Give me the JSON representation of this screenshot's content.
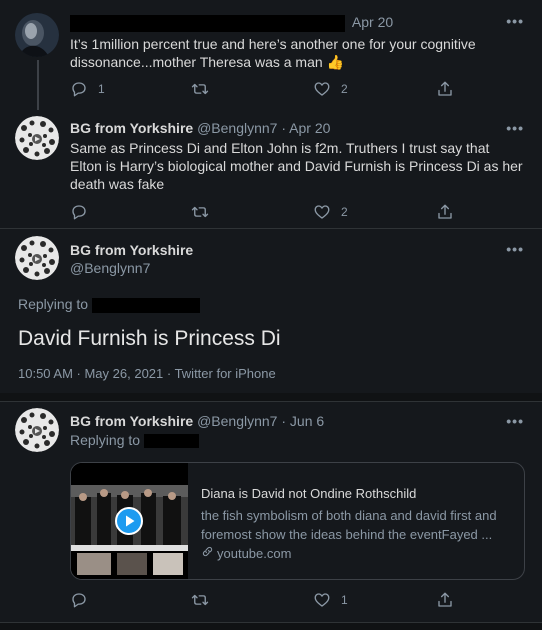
{
  "colors": {
    "background": "#15181c",
    "text": "#d9d9d9",
    "muted": "#8b98a5",
    "divider": "#2f3336",
    "play": "#1d9bf0"
  },
  "tweets": [
    {
      "date": "Apr 20",
      "text": "It’s 1million percent true and here’s another one for your cognitive dissonance...mother Theresa was a man",
      "emoji": "👍",
      "replies": "1",
      "retweets": "",
      "likes": "2"
    },
    {
      "name": "BG from Yorkshire",
      "handle": "@Benglynn7",
      "date": "· Apr 20",
      "text": "Same as Princess Di and Elton John is f2m. Truthers I trust say that Elton is Harry’s biological mother and David Furnish is Princess Di as her death was fake",
      "replies": "",
      "retweets": "",
      "likes": "2"
    }
  ],
  "focus": {
    "name": "BG from Yorkshire",
    "handle": "@Benglynn7",
    "replying_label": "Replying to",
    "text": "David Furnish is Princess Di",
    "meta": "10:50 AM · May 26, 2021 · Twitter for iPhone"
  },
  "reply": {
    "name": "BG from Yorkshire",
    "handle": "@Benglynn7",
    "date": "· Jun 6",
    "replying_label": "Replying to",
    "card": {
      "title": "Diana is David not Ondine Rothschild",
      "description": "the fish symbolism of both diana and david first and foremost show the ideas behind the eventFayed ...",
      "domain": "youtube.com"
    },
    "replies": "",
    "retweets": "",
    "likes": "1"
  },
  "more_glyph": "•••",
  "icons": [
    "reply-icon",
    "retweet-icon",
    "like-icon",
    "share-icon",
    "more-icon",
    "link-icon",
    "play-icon"
  ]
}
